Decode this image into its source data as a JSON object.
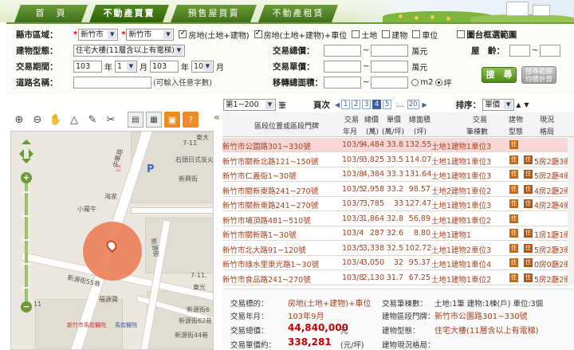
{
  "nav": {
    "tabs": [
      "首　頁",
      "不動產買賣",
      "預售屋買賣",
      "不動產租賃"
    ],
    "active": 1
  },
  "search": {
    "county_label": "縣市區域：",
    "county_value": "新竹市",
    "district_value": "新竹市",
    "types": [
      {
        "label": "房地(土地+建物)",
        "checked": true
      },
      {
        "label": "房地(土地+建物)+車位",
        "checked": true
      },
      {
        "label": "土地",
        "checked": false
      },
      {
        "label": "建物",
        "checked": false
      },
      {
        "label": "車位",
        "checked": false
      }
    ],
    "map_range_label": "圖台框選範圍",
    "map_range_checked": false,
    "building_type_label": "建物型態：",
    "building_type_value": "住宅大樓(11層含以上有電梯)",
    "total_price_label": "交易總價：",
    "total_price_unit": "萬元",
    "age_label": "屋　齡：",
    "tilde": "~",
    "period_label": "交易期間：",
    "period_from_year": "103",
    "period_from_month": "1",
    "period_to_year": "103",
    "period_to_month": "10",
    "year_unit": "年",
    "month_unit": "月",
    "month_unit_end": "月",
    "unit_price_label": "交易單價：",
    "unit_price_unit": "萬元",
    "road_label": "道路名稱：",
    "road_hint": "(可輸入任意字數)",
    "area_label": "移轉總面積：",
    "area_unit_m2": "m2",
    "area_unit_ping": "坪",
    "search_button": "搜　尋",
    "calc_button": "搜尋範圍\n均價計算"
  },
  "map": {
    "labels": {
      "road1": "中華路",
      "road2": "東大",
      "road3": "新源街",
      "road4": "新源街55巷",
      "road5": "新源街44巷",
      "place1": "石頭日式炭火",
      "place2": "海家",
      "place3": "小蘿牛",
      "place4": "福源寶",
      "place5": "新竹市馬偕醫院",
      "place6": "馬偕醫院",
      "num1": "7-11",
      "num2": "新源街6",
      "num3": "7-11.",
      "num4": "新源街62巷",
      "num5": "新興街",
      "num6": "東光",
      "num7": "11"
    }
  },
  "pager": {
    "range_value": "第1~200",
    "range_unit": "筆",
    "page_label": "頁次",
    "pages": [
      "1",
      "2",
      "3",
      "4",
      "5"
    ],
    "current_page": "4",
    "dots": "...",
    "last_page": "20",
    "sort_label": "排序：",
    "sort_value": "單價"
  },
  "table": {
    "headers": {
      "address": "區段位置或區段門牌",
      "date_top": "交易",
      "date_bottom": "年月",
      "total_top": "總價",
      "total_bottom": "(萬)",
      "unit_top": "單價",
      "unit_bottom": "(萬/坪)",
      "area_top": "總面積",
      "area_bottom": "(坪)",
      "items_top": "交易",
      "items_bottom": "筆棟數",
      "type_top": "建物",
      "type_bottom": "型態",
      "layout_top": "現況",
      "layout_bottom": "格局"
    },
    "badge": "住",
    "rows": [
      {
        "addr": "新竹市公園路301~330號",
        "date": "103/9",
        "total": "4,484",
        "unit": "33.8",
        "area": "132.55",
        "items": "土地1建物1車位3",
        "layout": "",
        "hl": true
      },
      {
        "addr": "新竹市關新北路121~150號",
        "date": "103/9",
        "total": "3,825",
        "unit": "33.5",
        "area": "114.07",
        "items": "土地1建物1車位3",
        "layout": "5房2廳3衛",
        "hl": false
      },
      {
        "addr": "新竹市仁義街1~30號",
        "date": "103/8",
        "total": "4,384",
        "unit": "33.3",
        "area": "131.64",
        "items": "土地1建物1車位3",
        "layout": "5房2廳4衛",
        "hl": false
      },
      {
        "addr": "新竹市關新東路241~270號",
        "date": "103/5",
        "total": "2,958",
        "unit": "33.2",
        "area": "98.57",
        "items": "土地2建物1車位2",
        "layout": "4房2廳2衛",
        "hl": false
      },
      {
        "addr": "新竹市關新東路241~270號",
        "date": "103/7",
        "total": "3,785",
        "unit": "33",
        "area": "127.47",
        "items": "土地1建物1車位3",
        "layout": "4房2廳4衛",
        "hl": false
      },
      {
        "addr": "新竹市埔頂路481~510號",
        "date": "103/3",
        "total": "1,864",
        "unit": "32.8",
        "area": "56.89",
        "items": "土地1建物1車位2",
        "layout": "",
        "hl": false
      },
      {
        "addr": "新竹市關新路1~30號",
        "date": "103/4",
        "total": "287",
        "unit": "32.6",
        "area": "8.80",
        "items": "土地1建物1",
        "layout": "1房1廳1衛",
        "hl": false
      },
      {
        "addr": "新竹市北大路91~120號",
        "date": "103/5",
        "total": "3,338",
        "unit": "32.5",
        "area": "102.72",
        "items": "土地1建物2車位3",
        "layout": "5房2廳3衛",
        "hl": false
      },
      {
        "addr": "新竹市綠水里東光路1~30號",
        "date": "103/4",
        "total": "3,050",
        "unit": "32",
        "area": "95.37",
        "items": "土地1建物1車位4",
        "layout": "0房0廳2衛",
        "hl": false
      },
      {
        "addr": "新竹市食品路241~270號",
        "date": "103/8",
        "total": "2,130",
        "unit": "31.7",
        "area": "67.25",
        "items": "土地1建物1車位2",
        "layout": "5房2廳2衛",
        "hl": false
      }
    ]
  },
  "detail": {
    "target_label": "交易標的：",
    "target_value": "房地(土地+建物)+車位",
    "date_label": "交易年月：",
    "date_value": "103年9月",
    "total_label": "交易總價：",
    "total_value": "44,840,000",
    "total_unit": "元",
    "unit_label": "交易單價約：",
    "unit_value": "338,281",
    "unit_unit": "(元/坪)",
    "count_label": "交易筆棟數：",
    "count_value": "土地:1筆 建物:1棟(戶) 車位:3個",
    "addr_label": "建物區段門牌：",
    "addr_value": "新竹市公園路301~330號",
    "btype_label": "建物型態：",
    "btype_value": "住宅大樓(11層含以上有電梯)",
    "state_label": "建物現況格局："
  },
  "colors": {
    "accent": "#6b9a36",
    "link": "#a6421f",
    "highlight_row": "#f8d7d7",
    "circle": "#eb7850"
  },
  "icons": [
    "zoom-in-icon",
    "zoom-out-icon",
    "hand-icon",
    "measure-icon",
    "pen-icon",
    "clear-icon",
    "print-icon",
    "layers-icon",
    "legend-icon",
    "info-icon"
  ]
}
